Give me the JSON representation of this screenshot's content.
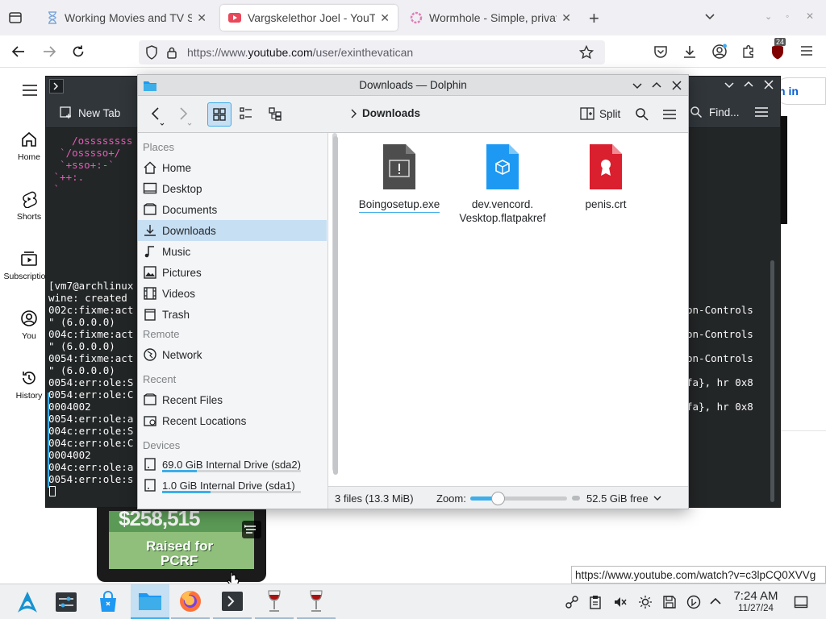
{
  "firefox": {
    "tabs": [
      {
        "label": "Working Movies and TV Sh",
        "icon": "hourglass-icon"
      },
      {
        "label": "Vargskelethor Joel - YouTu",
        "icon": "youtube-icon"
      },
      {
        "label": "Wormhole - Simple, privat",
        "icon": "wormhole-icon"
      }
    ],
    "new_tab": "+",
    "url_prefix": "https://www.",
    "url_domain": "youtube.com",
    "url_path": "/user/exinthevatican",
    "extension_badge": "24"
  },
  "youtube": {
    "sidebar": [
      {
        "label": "Home"
      },
      {
        "label": "Shorts"
      },
      {
        "label": "Subscriptions"
      },
      {
        "label": "You"
      },
      {
        "label": "History"
      }
    ],
    "sign_in": "n in",
    "thumbnail_text_top": "$258,515",
    "thumbnail_text_mid": "Raised for",
    "thumbnail_text_bottom": "PCRF",
    "status_url": "https://www.youtube.com/watch?v=c3lpCQ0XVVg"
  },
  "konsole": {
    "new_tab": "New Tab",
    "find": "Find...",
    "ascii_lines": [
      "    /ossssssss",
      "  `/osssso+/",
      "  `+sso+:-`",
      " `++:.",
      " `"
    ],
    "log_lines": [
      "[vm7@archlinux",
      "wine: created",
      "002c:fixme:act",
      "\" (6.0.0.0)",
      "004c:fixme:act",
      "\" (6.0.0.0)",
      "0054:fixme:act",
      "\" (6.0.0.0)",
      "0054:err:ole:S",
      "0054:err:ole:C",
      "0004002",
      "0054:err:ole:a",
      "004c:err:ole:S",
      "004c:err:ole:C",
      "0004002",
      "004c:err:ole:a",
      "0054:err:ole:s"
    ],
    "right_lines": [
      "on-Controls",
      "on-Controls",
      "on-Controls",
      "fa}, hr 0x8",
      "fa}, hr 0x8"
    ]
  },
  "dolphin": {
    "title": "Downloads — Dolphin",
    "split": "Split",
    "breadcrumb": "Downloads",
    "places_header": "Places",
    "places": [
      "Home",
      "Desktop",
      "Documents",
      "Downloads",
      "Music",
      "Pictures",
      "Videos",
      "Trash"
    ],
    "remote_header": "Remote",
    "remote": [
      "Network"
    ],
    "recent_header": "Recent",
    "recent": [
      "Recent Files",
      "Recent Locations"
    ],
    "devices_header": "Devices",
    "devices": [
      {
        "label": "69.0 GiB Internal Drive (sda2)",
        "used_fraction": 0.25
      },
      {
        "label": "1.0 GiB Internal Drive (sda1)",
        "used_fraction": 0.35
      }
    ],
    "files": [
      {
        "name": "Boingosetup.exe"
      },
      {
        "name": "dev.vencord.",
        "name2": "Vesktop.flatpakref"
      },
      {
        "name": "penis.crt"
      }
    ],
    "status_count": "3 files (13.3 MiB)",
    "zoom_label": "Zoom:",
    "zoom_fraction": 0.28,
    "free_space": "52.5 GiB free"
  },
  "taskbar": {
    "clock_time": "7:24 AM",
    "clock_date": "11/27/24"
  }
}
